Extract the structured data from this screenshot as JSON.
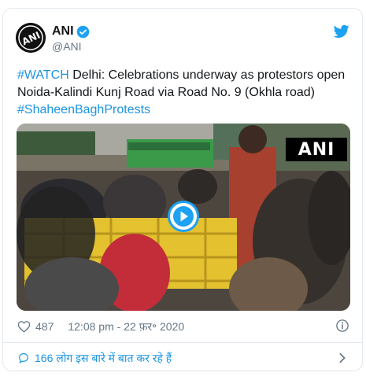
{
  "tweet": {
    "author_name": "ANI",
    "author_handle": "@ANI",
    "text_prefix_hashtag": "#WATCH",
    "text_body": " Delhi: Celebrations underway as protestors open Noida-Kalindi Kunj Road via Road No. 9 (Okhla road) ",
    "text_suffix_hashtag": "#ShaheenBaghProtests",
    "video_watermark": "ANI",
    "like_count": "487",
    "timestamp": "12:08 pm - 22 फ़र॰ 2020",
    "conversation_text": "166 लोग इस बारे में बात कर रहे हैं"
  },
  "colors": {
    "accent": "#1da1f2",
    "link": "#1b95e0",
    "secondary_text": "#657786",
    "border": "#e1e8ed"
  },
  "icons": {
    "avatar": "ani-avatar-logo",
    "verified": "verified-badge-icon",
    "brand": "twitter-bird-icon",
    "play": "play-icon",
    "like": "heart-icon",
    "info": "info-icon",
    "reply": "speech-bubble-icon",
    "more": "chevron-right-icon"
  }
}
